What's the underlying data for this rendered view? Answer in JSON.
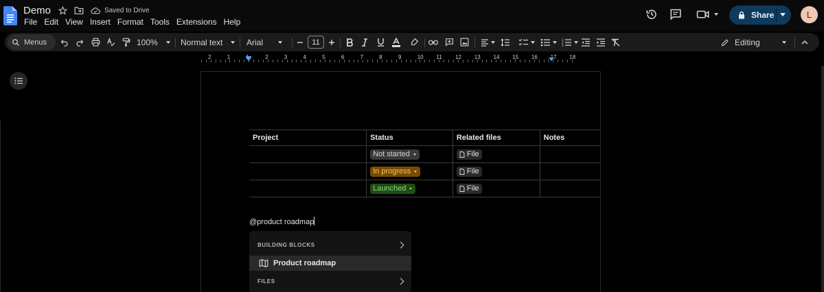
{
  "header": {
    "doc_title": "Demo",
    "saved_status": "Saved to Drive",
    "share_label": "Share",
    "avatar_initial": "L"
  },
  "menubar": {
    "items": [
      "File",
      "Edit",
      "View",
      "Insert",
      "Format",
      "Tools",
      "Extensions",
      "Help"
    ]
  },
  "toolbar": {
    "menus_label": "Menus",
    "zoom": "100%",
    "style": "Normal text",
    "font": "Arial",
    "font_size": "11",
    "mode": "Editing"
  },
  "ruler": {
    "numbers": [
      "2",
      "1",
      "1",
      "2",
      "3",
      "4",
      "5",
      "6",
      "7",
      "8",
      "9",
      "10",
      "11",
      "12",
      "13",
      "14",
      "15",
      "16",
      "17",
      "18"
    ]
  },
  "table": {
    "headers": [
      "Project",
      "Status",
      "Related files",
      "Notes"
    ],
    "rows": [
      {
        "project": "",
        "status": "Not started",
        "file": "File",
        "notes": ""
      },
      {
        "project": "",
        "status": "In progress",
        "file": "File",
        "notes": ""
      },
      {
        "project": "",
        "status": "Launched",
        "file": "File",
        "notes": ""
      }
    ]
  },
  "status_colors": {
    "not_started_bg": "#3a3a3a",
    "not_started_fg": "#d6d6d6",
    "in_progress_bg": "#7a4a00",
    "in_progress_fg": "#f5c56b",
    "launched_bg": "#1f4d14",
    "launched_fg": "#8fd67a"
  },
  "editor": {
    "mention_text": "@product roadmap"
  },
  "popup": {
    "section_building_blocks": "BUILDING BLOCKS",
    "highlighted_item": "Product roadmap",
    "section_files": "FILES"
  }
}
